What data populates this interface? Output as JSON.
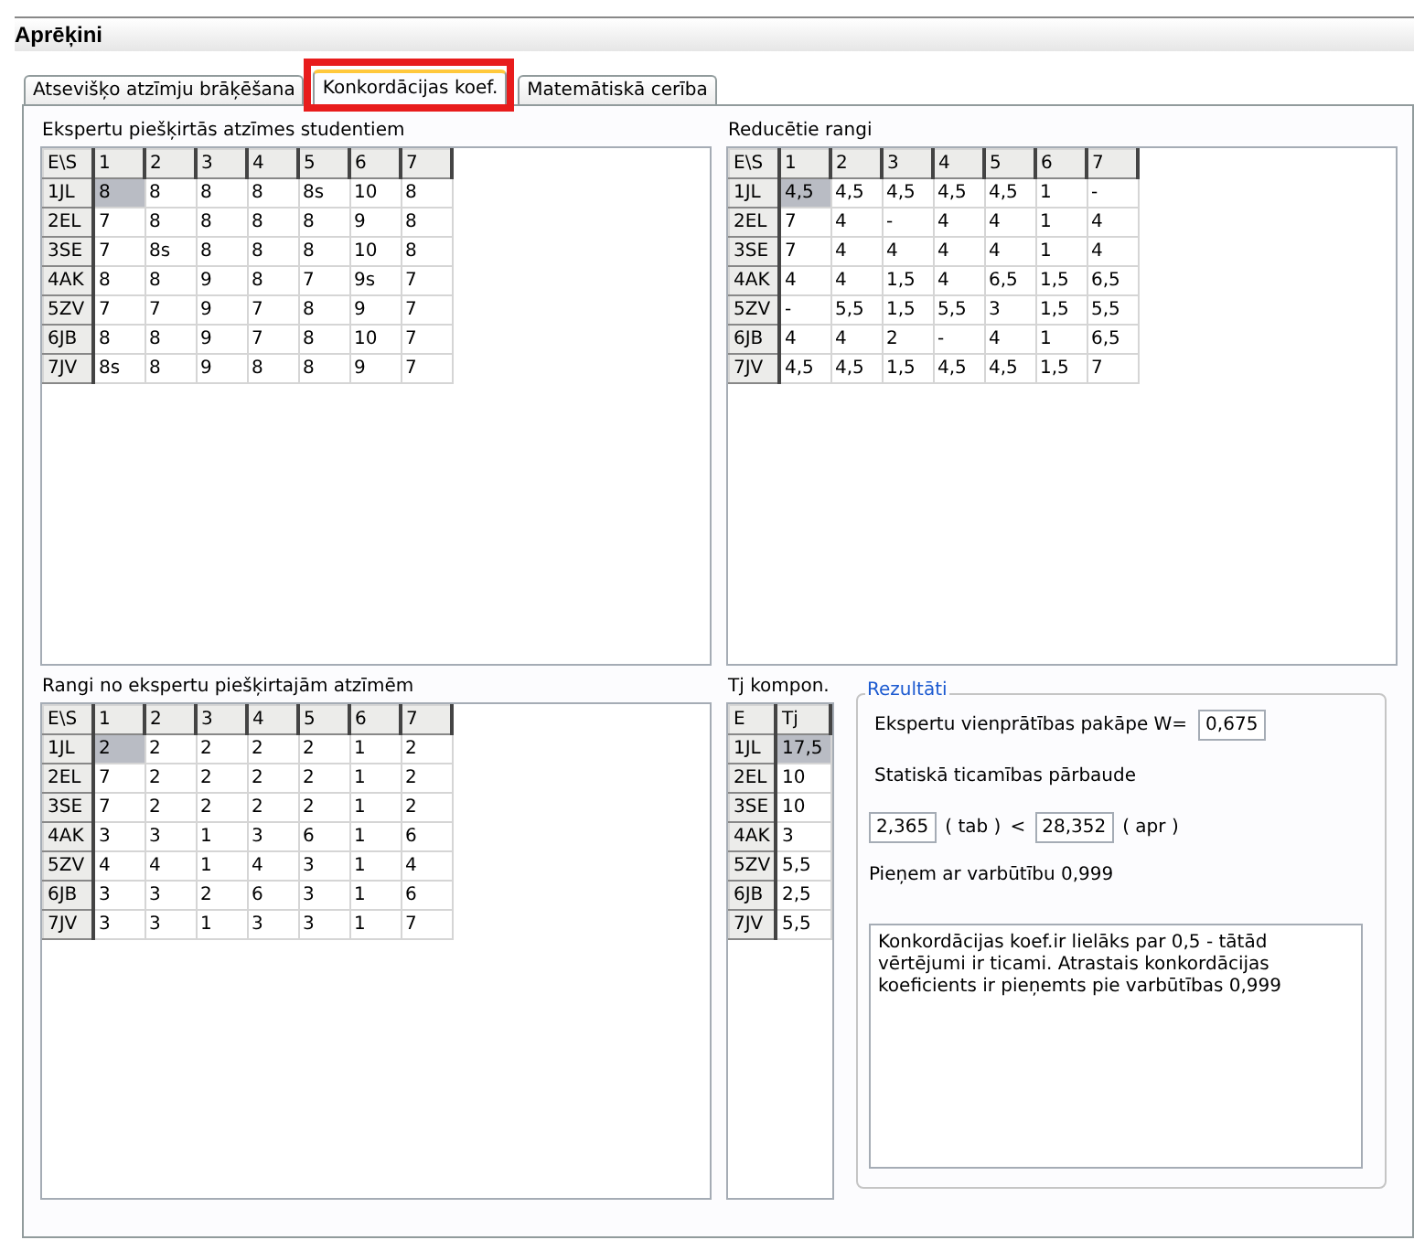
{
  "window": {
    "title": "Aprēķini"
  },
  "tabs": [
    {
      "label": "Atsevišķo atzīmju brāķēšana",
      "selected": false,
      "highlighted": false
    },
    {
      "label": "Konkordācijas koef.",
      "selected": true,
      "highlighted": true
    },
    {
      "label": "Matemātiskā cerība",
      "selected": false,
      "highlighted": false
    }
  ],
  "grids": [
    {
      "title": "Ekspertu piešķirtās atzīmes studentiem",
      "corner": "E\\S",
      "columns": [
        "1",
        "2",
        "3",
        "4",
        "5",
        "6",
        "7"
      ],
      "rows": [
        {
          "header": "1JL",
          "cells": [
            {
              "v": "8",
              "selected": true
            },
            {
              "v": "8",
              "selected": false
            },
            {
              "v": "8",
              "selected": false
            },
            {
              "v": "8",
              "selected": false
            },
            {
              "v": "8s",
              "selected": false
            },
            {
              "v": "10",
              "selected": false
            },
            {
              "v": "8",
              "selected": false
            }
          ]
        },
        {
          "header": "2EL",
          "cells": [
            {
              "v": "7",
              "selected": false
            },
            {
              "v": "8",
              "selected": false
            },
            {
              "v": "8",
              "selected": false
            },
            {
              "v": "8",
              "selected": false
            },
            {
              "v": "8",
              "selected": false
            },
            {
              "v": "9",
              "selected": false
            },
            {
              "v": "8",
              "selected": false
            }
          ]
        },
        {
          "header": "3SE",
          "cells": [
            {
              "v": "7",
              "selected": false
            },
            {
              "v": "8s",
              "selected": false
            },
            {
              "v": "8",
              "selected": false
            },
            {
              "v": "8",
              "selected": false
            },
            {
              "v": "8",
              "selected": false
            },
            {
              "v": "10",
              "selected": false
            },
            {
              "v": "8",
              "selected": false
            }
          ]
        },
        {
          "header": "4AK",
          "cells": [
            {
              "v": "8",
              "selected": false
            },
            {
              "v": "8",
              "selected": false
            },
            {
              "v": "9",
              "selected": false
            },
            {
              "v": "8",
              "selected": false
            },
            {
              "v": "7",
              "selected": false
            },
            {
              "v": "9s",
              "selected": false
            },
            {
              "v": "7",
              "selected": false
            }
          ]
        },
        {
          "header": "5ZV",
          "cells": [
            {
              "v": "7",
              "selected": false
            },
            {
              "v": "7",
              "selected": false
            },
            {
              "v": "9",
              "selected": false
            },
            {
              "v": "7",
              "selected": false
            },
            {
              "v": "8",
              "selected": false
            },
            {
              "v": "9",
              "selected": false
            },
            {
              "v": "7",
              "selected": false
            }
          ]
        },
        {
          "header": "6JB",
          "cells": [
            {
              "v": "8",
              "selected": false
            },
            {
              "v": "8",
              "selected": false
            },
            {
              "v": "9",
              "selected": false
            },
            {
              "v": "7",
              "selected": false
            },
            {
              "v": "8",
              "selected": false
            },
            {
              "v": "10",
              "selected": false
            },
            {
              "v": "7",
              "selected": false
            }
          ]
        },
        {
          "header": "7JV",
          "cells": [
            {
              "v": "8s",
              "selected": false
            },
            {
              "v": "8",
              "selected": false
            },
            {
              "v": "9",
              "selected": false
            },
            {
              "v": "8",
              "selected": false
            },
            {
              "v": "8",
              "selected": false
            },
            {
              "v": "9",
              "selected": false
            },
            {
              "v": "7",
              "selected": false
            }
          ]
        }
      ]
    },
    {
      "title": "Reducētie rangi",
      "corner": "E\\S",
      "columns": [
        "1",
        "2",
        "3",
        "4",
        "5",
        "6",
        "7"
      ],
      "rows": [
        {
          "header": "1JL",
          "cells": [
            {
              "v": "4,5",
              "selected": true
            },
            {
              "v": "4,5",
              "selected": false
            },
            {
              "v": "4,5",
              "selected": false
            },
            {
              "v": "4,5",
              "selected": false
            },
            {
              "v": "4,5",
              "selected": false
            },
            {
              "v": "1",
              "selected": false
            },
            {
              "v": "-",
              "selected": false
            }
          ]
        },
        {
          "header": "2EL",
          "cells": [
            {
              "v": "7",
              "selected": false
            },
            {
              "v": "4",
              "selected": false
            },
            {
              "v": "-",
              "selected": false
            },
            {
              "v": "4",
              "selected": false
            },
            {
              "v": "4",
              "selected": false
            },
            {
              "v": "1",
              "selected": false
            },
            {
              "v": "4",
              "selected": false
            }
          ]
        },
        {
          "header": "3SE",
          "cells": [
            {
              "v": "7",
              "selected": false
            },
            {
              "v": "4",
              "selected": false
            },
            {
              "v": "4",
              "selected": false
            },
            {
              "v": "4",
              "selected": false
            },
            {
              "v": "4",
              "selected": false
            },
            {
              "v": "1",
              "selected": false
            },
            {
              "v": "4",
              "selected": false
            }
          ]
        },
        {
          "header": "4AK",
          "cells": [
            {
              "v": "4",
              "selected": false
            },
            {
              "v": "4",
              "selected": false
            },
            {
              "v": "1,5",
              "selected": false
            },
            {
              "v": "4",
              "selected": false
            },
            {
              "v": "6,5",
              "selected": false
            },
            {
              "v": "1,5",
              "selected": false
            },
            {
              "v": "6,5",
              "selected": false
            }
          ]
        },
        {
          "header": "5ZV",
          "cells": [
            {
              "v": "-",
              "selected": false
            },
            {
              "v": "5,5",
              "selected": false
            },
            {
              "v": "1,5",
              "selected": false
            },
            {
              "v": "5,5",
              "selected": false
            },
            {
              "v": "3",
              "selected": false
            },
            {
              "v": "1,5",
              "selected": false
            },
            {
              "v": "5,5",
              "selected": false
            }
          ]
        },
        {
          "header": "6JB",
          "cells": [
            {
              "v": "4",
              "selected": false
            },
            {
              "v": "4",
              "selected": false
            },
            {
              "v": "2",
              "selected": false
            },
            {
              "v": "-",
              "selected": false
            },
            {
              "v": "4",
              "selected": false
            },
            {
              "v": "1",
              "selected": false
            },
            {
              "v": "6,5",
              "selected": false
            }
          ]
        },
        {
          "header": "7JV",
          "cells": [
            {
              "v": "4,5",
              "selected": false
            },
            {
              "v": "4,5",
              "selected": false
            },
            {
              "v": "1,5",
              "selected": false
            },
            {
              "v": "4,5",
              "selected": false
            },
            {
              "v": "4,5",
              "selected": false
            },
            {
              "v": "1,5",
              "selected": false
            },
            {
              "v": "7",
              "selected": false
            }
          ]
        }
      ]
    },
    {
      "title": "Rangi no ekspertu piešķirtajām atzīmēm",
      "corner": "E\\S",
      "columns": [
        "1",
        "2",
        "3",
        "4",
        "5",
        "6",
        "7"
      ],
      "rows": [
        {
          "header": "1JL",
          "cells": [
            {
              "v": "2",
              "selected": true
            },
            {
              "v": "2",
              "selected": false
            },
            {
              "v": "2",
              "selected": false
            },
            {
              "v": "2",
              "selected": false
            },
            {
              "v": "2",
              "selected": false
            },
            {
              "v": "1",
              "selected": false
            },
            {
              "v": "2",
              "selected": false
            }
          ]
        },
        {
          "header": "2EL",
          "cells": [
            {
              "v": "7",
              "selected": false
            },
            {
              "v": "2",
              "selected": false
            },
            {
              "v": "2",
              "selected": false
            },
            {
              "v": "2",
              "selected": false
            },
            {
              "v": "2",
              "selected": false
            },
            {
              "v": "1",
              "selected": false
            },
            {
              "v": "2",
              "selected": false
            }
          ]
        },
        {
          "header": "3SE",
          "cells": [
            {
              "v": "7",
              "selected": false
            },
            {
              "v": "2",
              "selected": false
            },
            {
              "v": "2",
              "selected": false
            },
            {
              "v": "2",
              "selected": false
            },
            {
              "v": "2",
              "selected": false
            },
            {
              "v": "1",
              "selected": false
            },
            {
              "v": "2",
              "selected": false
            }
          ]
        },
        {
          "header": "4AK",
          "cells": [
            {
              "v": "3",
              "selected": false
            },
            {
              "v": "3",
              "selected": false
            },
            {
              "v": "1",
              "selected": false
            },
            {
              "v": "3",
              "selected": false
            },
            {
              "v": "6",
              "selected": false
            },
            {
              "v": "1",
              "selected": false
            },
            {
              "v": "6",
              "selected": false
            }
          ]
        },
        {
          "header": "5ZV",
          "cells": [
            {
              "v": "4",
              "selected": false
            },
            {
              "v": "4",
              "selected": false
            },
            {
              "v": "1",
              "selected": false
            },
            {
              "v": "4",
              "selected": false
            },
            {
              "v": "3",
              "selected": false
            },
            {
              "v": "1",
              "selected": false
            },
            {
              "v": "4",
              "selected": false
            }
          ]
        },
        {
          "header": "6JB",
          "cells": [
            {
              "v": "3",
              "selected": false
            },
            {
              "v": "3",
              "selected": false
            },
            {
              "v": "2",
              "selected": false
            },
            {
              "v": "6",
              "selected": false
            },
            {
              "v": "3",
              "selected": false
            },
            {
              "v": "1",
              "selected": false
            },
            {
              "v": "6",
              "selected": false
            }
          ]
        },
        {
          "header": "7JV",
          "cells": [
            {
              "v": "3",
              "selected": false
            },
            {
              "v": "3",
              "selected": false
            },
            {
              "v": "1",
              "selected": false
            },
            {
              "v": "3",
              "selected": false
            },
            {
              "v": "3",
              "selected": false
            },
            {
              "v": "1",
              "selected": false
            },
            {
              "v": "7",
              "selected": false
            }
          ]
        }
      ]
    },
    {
      "title": "Tj kompon.",
      "corner": "E",
      "columns": [
        "Tj"
      ],
      "rows": [
        {
          "header": "1JL",
          "cells": [
            {
              "v": "17,5",
              "selected": true
            }
          ]
        },
        {
          "header": "2EL",
          "cells": [
            {
              "v": "10",
              "selected": false
            }
          ]
        },
        {
          "header": "3SE",
          "cells": [
            {
              "v": "10",
              "selected": false
            }
          ]
        },
        {
          "header": "4AK",
          "cells": [
            {
              "v": "3",
              "selected": false
            }
          ]
        },
        {
          "header": "5ZV",
          "cells": [
            {
              "v": "5,5",
              "selected": false
            }
          ]
        },
        {
          "header": "6JB",
          "cells": [
            {
              "v": "2,5",
              "selected": false
            }
          ]
        },
        {
          "header": "7JV",
          "cells": [
            {
              "v": "5,5",
              "selected": false
            }
          ]
        }
      ]
    }
  ],
  "results": {
    "title": "Rezultāti",
    "w_label": "Ekspertu vienprātības pakāpe W=",
    "w_value": "0,675",
    "test_label": "Statiskā ticamības pārbaude",
    "tab_value": "2,365",
    "tab_label": "( tab )",
    "compare": "<",
    "apr_value": "28,352",
    "apr_label": "( apr )",
    "probability": "Pieņem ar varbūtību 0,999",
    "conclusion": "Konkordācijas koef.ir lielāks par 0,5 - tātād vērtējumi ir ticami. Atrastais konkordācijas koeficients ir pieņemts pie varbūtības 0,999"
  }
}
